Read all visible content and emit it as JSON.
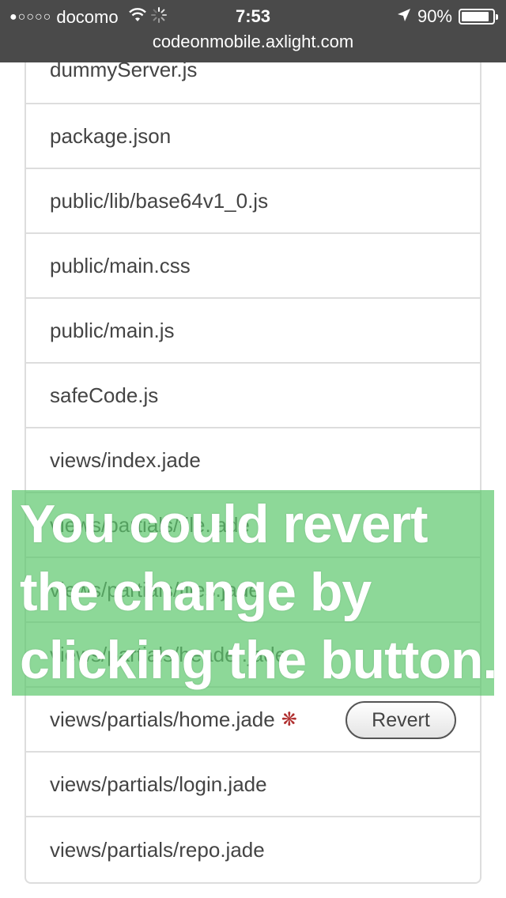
{
  "status_bar": {
    "signal_dots": "●○○○○",
    "carrier": "docomo",
    "wifi_icon": "wifi-icon",
    "activity_icon": "activity-spinner-icon",
    "time": "7:53",
    "location_icon": "location-arrow-icon",
    "battery_percent": "90%",
    "battery_level": 0.9
  },
  "url_bar": {
    "url": "codeonmobile.axlight.com"
  },
  "file_list": {
    "items": [
      {
        "name": "dummyServer.js"
      },
      {
        "name": "package.json"
      },
      {
        "name": "public/lib/base64v1_0.js"
      },
      {
        "name": "public/main.css"
      },
      {
        "name": "public/main.js"
      },
      {
        "name": "safeCode.js"
      },
      {
        "name": "views/index.jade"
      },
      {
        "name": "views/partials/file.jade"
      },
      {
        "name": "views/partials/files.jade"
      },
      {
        "name": "views/partials/header.jade"
      },
      {
        "name": "views/partials/home.jade",
        "modified": true,
        "modified_marker": "❋",
        "action_label": "Revert"
      },
      {
        "name": "views/partials/login.jade"
      },
      {
        "name": "views/partials/repo.jade"
      }
    ]
  },
  "overlay": {
    "lines": [
      "You could revert",
      "the change by",
      "clicking the button."
    ],
    "background_color": "#5cc86c"
  }
}
